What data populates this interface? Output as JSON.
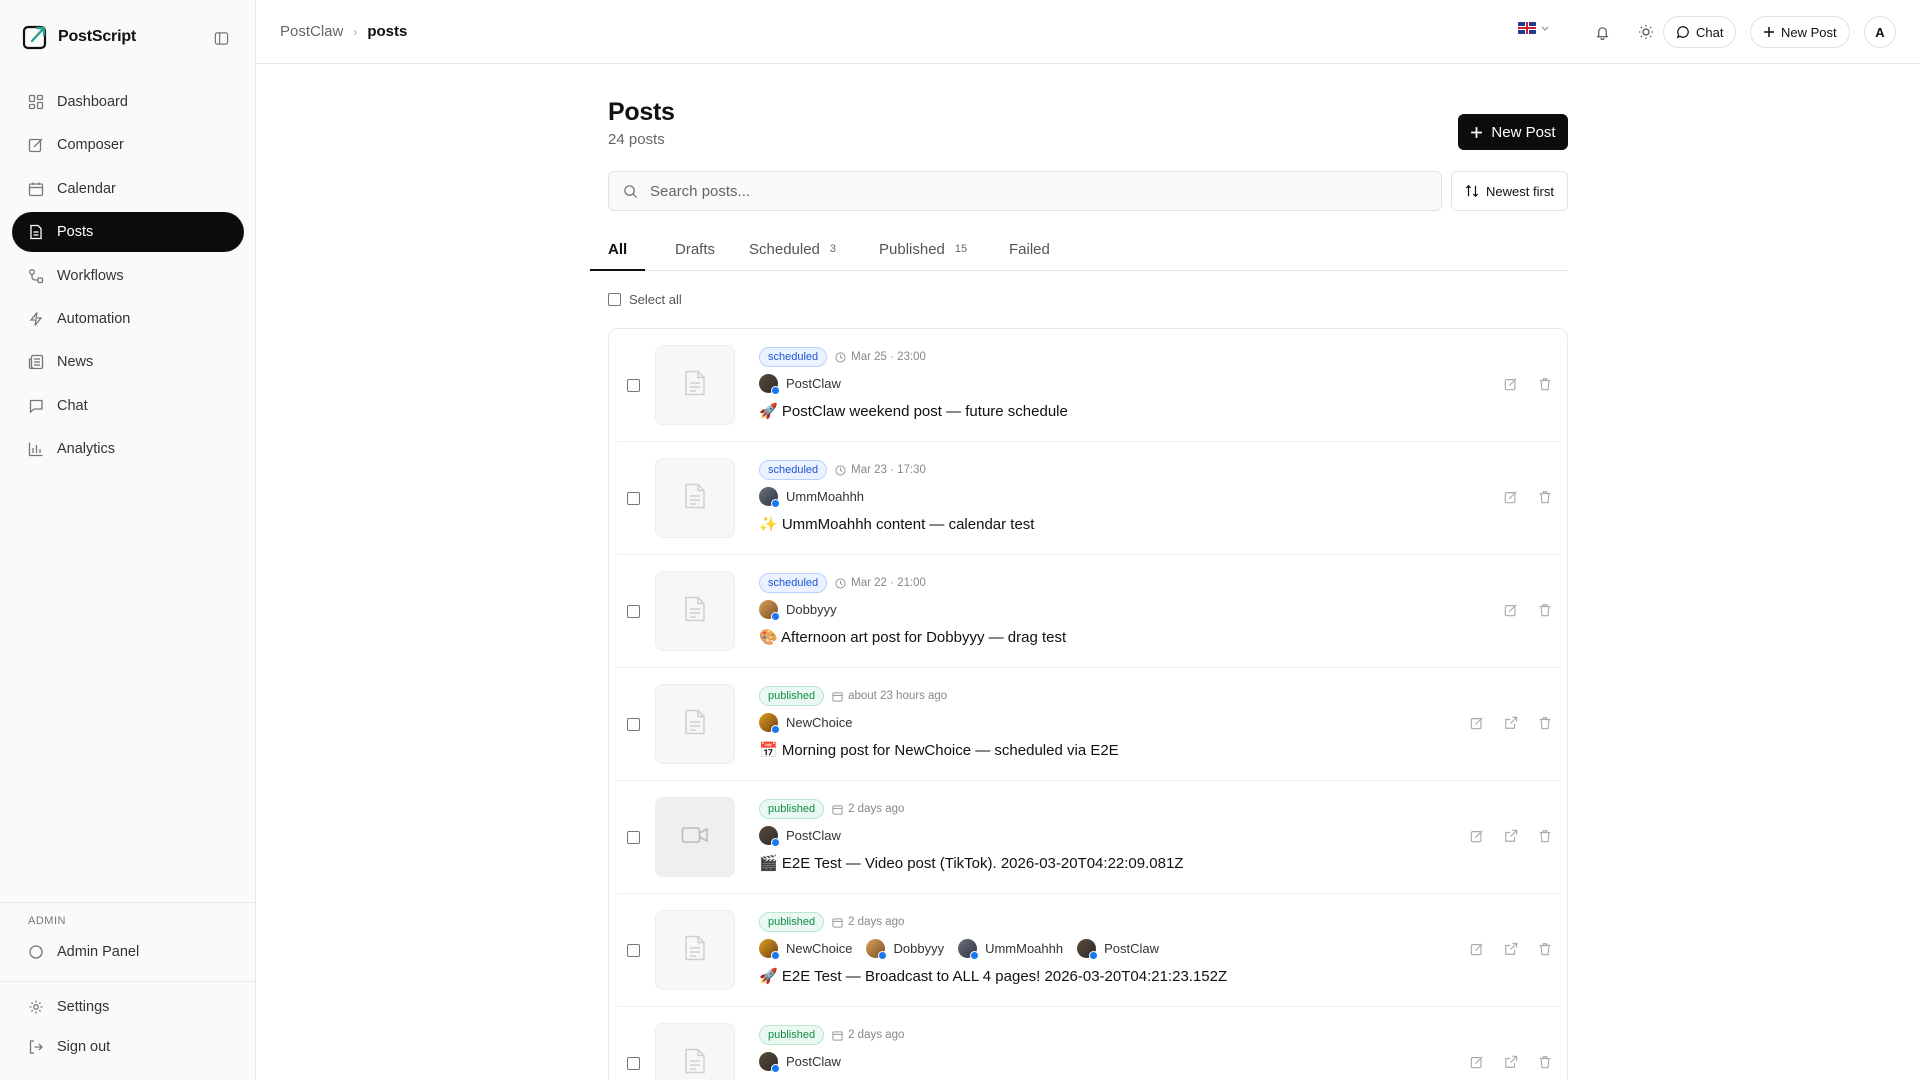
{
  "brand": {
    "name": "PostScript"
  },
  "sidebar": {
    "items": [
      {
        "label": "Dashboard",
        "icon": "dashboard-icon"
      },
      {
        "label": "Composer",
        "icon": "compose-icon"
      },
      {
        "label": "Calendar",
        "icon": "calendar-icon"
      },
      {
        "label": "Posts",
        "icon": "document-icon",
        "active": true
      },
      {
        "label": "Workflows",
        "icon": "workflow-icon"
      },
      {
        "label": "Automation",
        "icon": "bolt-icon"
      },
      {
        "label": "News",
        "icon": "newspaper-icon"
      },
      {
        "label": "Chat",
        "icon": "chat-icon"
      },
      {
        "label": "Analytics",
        "icon": "bar-chart-icon"
      }
    ],
    "admin_label": "ADMIN",
    "admin_panel": "Admin Panel",
    "settings": "Settings",
    "sign_out": "Sign out"
  },
  "header": {
    "breadcrumb_parent": "PostClaw",
    "breadcrumb_current": "posts",
    "chat_label": "Chat",
    "new_post_label": "New Post",
    "avatar_initial": "A"
  },
  "main": {
    "title": "Posts",
    "count": "24 posts",
    "new_post_label": "New Post",
    "search_placeholder": "Search posts...",
    "sort_label": "Newest first",
    "select_all": "Select all",
    "tabs": [
      {
        "label": "All",
        "count": ""
      },
      {
        "label": "Drafts",
        "count": ""
      },
      {
        "label": "Scheduled",
        "count": "3"
      },
      {
        "label": "Published",
        "count": "15"
      },
      {
        "label": "Failed",
        "count": ""
      }
    ]
  },
  "posts": [
    {
      "status": "scheduled",
      "time": "Mar 25 · 23:00",
      "accounts": [
        "PostClaw"
      ],
      "text": "🚀 PostClaw weekend post — future schedule",
      "thumb": "document"
    },
    {
      "status": "scheduled",
      "time": "Mar 23 · 17:30",
      "accounts": [
        "UmmMoahhh"
      ],
      "text": "✨ UmmMoahhh content — calendar test",
      "thumb": "document"
    },
    {
      "status": "scheduled",
      "time": "Mar 22 · 21:00",
      "accounts": [
        "Dobbyyy"
      ],
      "text": "🎨 Afternoon art post for Dobbyyy — drag test",
      "thumb": "document"
    },
    {
      "status": "published",
      "time": "about 23 hours ago",
      "accounts": [
        "NewChoice"
      ],
      "text": "📅 Morning post for NewChoice — scheduled via E2E",
      "thumb": "document"
    },
    {
      "status": "published",
      "time": "2 days ago",
      "accounts": [
        "PostClaw"
      ],
      "text": "🎬 E2E Test — Video post (TikTok). 2026-03-20T04:22:09.081Z",
      "thumb": "video"
    },
    {
      "status": "published",
      "time": "2 days ago",
      "accounts": [
        "NewChoice",
        "Dobbyyy",
        "UmmMoahhh",
        "PostClaw"
      ],
      "text": "🚀 E2E Test — Broadcast to ALL 4 pages! 2026-03-20T04:21:23.152Z",
      "thumb": "document"
    },
    {
      "status": "published",
      "time": "2 days ago",
      "accounts": [
        "PostClaw"
      ],
      "text": "",
      "thumb": "document"
    }
  ],
  "colors": {
    "accent": "#0c0c0c",
    "scheduled": "#2156d6",
    "published": "#128a4a",
    "facebook": "#1877f2"
  }
}
